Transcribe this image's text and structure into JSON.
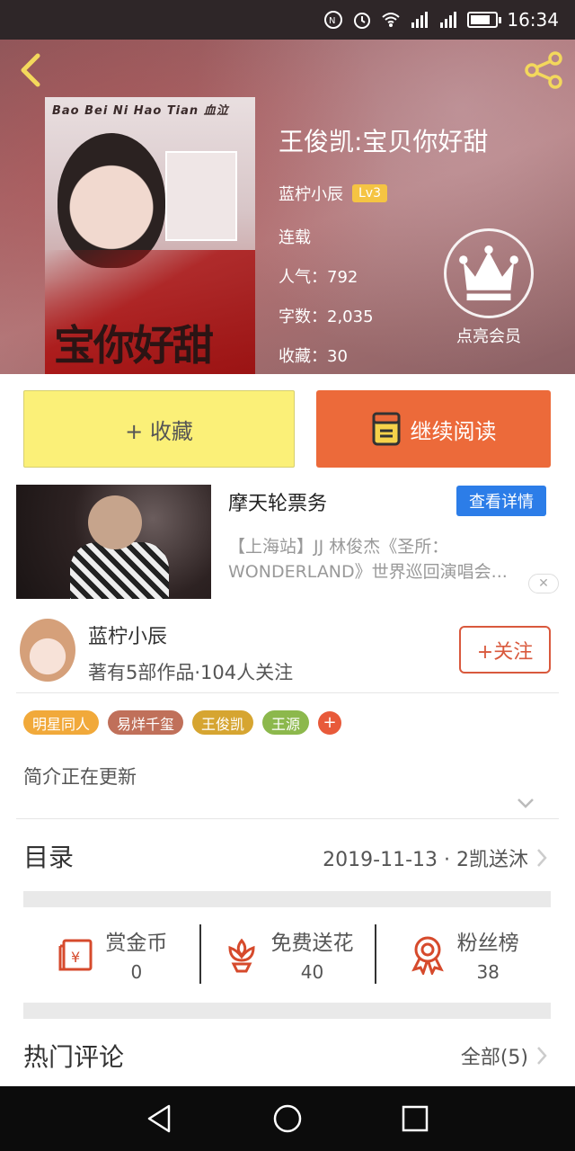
{
  "status_bar": {
    "time": "16:34",
    "signal1": "2G",
    "signal2": "3G"
  },
  "book": {
    "title": "王俊凯:宝贝你好甜",
    "author": "蓝柠小辰",
    "level": "Lv3",
    "status": "连载",
    "popularity": "人气：792",
    "words": "字数：2,035",
    "favorites": "收藏：30",
    "cover_text_top": "Bao Bei Ni Hao Tian 血泣",
    "cover_title": "宝你好甜"
  },
  "vip": {
    "label": "点亮会员"
  },
  "actions": {
    "favorite": "+ 收藏",
    "continue": "继续阅读"
  },
  "ad": {
    "title": "摩天轮票务",
    "detail_button": "查看详情",
    "desc_line1": "【上海站】JJ 林俊杰《圣所：",
    "desc_line2": "WONDERLAND》世界巡回演唱会...",
    "close": "✕"
  },
  "author_section": {
    "name": "蓝柠小辰",
    "stats": "著有5部作品·104人关注",
    "follow": "+关注"
  },
  "tags": [
    {
      "label": "明星同人",
      "color": "#f1a93a"
    },
    {
      "label": "易烊千玺",
      "color": "#c0705a"
    },
    {
      "label": "王俊凯",
      "color": "#d6a531"
    },
    {
      "label": "王源",
      "color": "#8cb84c"
    }
  ],
  "tag_add": "+",
  "intro": "简介正在更新",
  "toc": {
    "label": "目录",
    "latest": "2019-11-13 · 2凯送沐"
  },
  "stats": [
    {
      "name": "赏金币",
      "value": "0",
      "icon": "red-envelope-icon"
    },
    {
      "name": "免费送花",
      "value": "40",
      "icon": "flower-icon"
    },
    {
      "name": "粉丝榜",
      "value": "38",
      "icon": "ribbon-medal-icon"
    }
  ],
  "comments": {
    "label": "热门评论",
    "all": "全部(5)"
  },
  "colors": {
    "accent_orange": "#ec6a3a",
    "favorite_yellow": "#fbf078",
    "follow_red": "#d9593d",
    "ad_blue": "#2c7de8"
  }
}
